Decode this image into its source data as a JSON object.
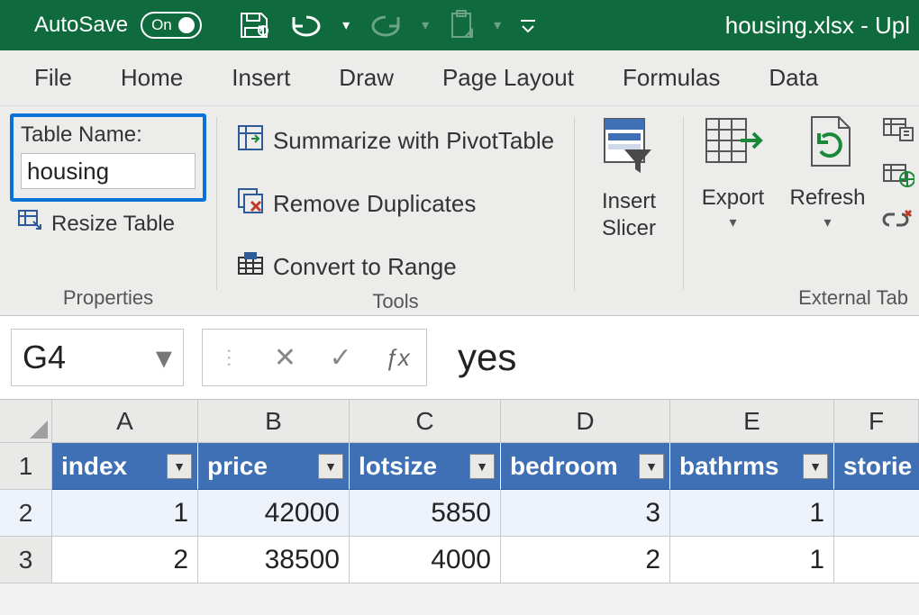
{
  "titlebar": {
    "autosave_label": "AutoSave",
    "autosave_state": "On",
    "doc_title": "housing.xlsx  -  Upl"
  },
  "tabs": {
    "file": "File",
    "home": "Home",
    "insert": "Insert",
    "draw": "Draw",
    "page_layout": "Page Layout",
    "formulas": "Formulas",
    "data": "Data"
  },
  "ribbon": {
    "properties": {
      "label": "Properties",
      "table_name_label": "Table Name:",
      "table_name_value": "housing",
      "resize_table": "Resize Table"
    },
    "tools": {
      "label": "Tools",
      "summarize": "Summarize with PivotTable",
      "remove_dups": "Remove Duplicates",
      "convert_range": "Convert to Range"
    },
    "slicer": {
      "line1": "Insert",
      "line2": "Slicer"
    },
    "export": "Export",
    "refresh": "Refresh",
    "external_label": "External Tab"
  },
  "formula": {
    "namebox": "G4",
    "value": "yes"
  },
  "sheet": {
    "columns": [
      "A",
      "B",
      "C",
      "D",
      "E",
      "F"
    ],
    "header": {
      "A": "index",
      "B": "price",
      "C": "lotsize",
      "D": "bedroom",
      "E": "bathrms",
      "F": "storie"
    },
    "rows": [
      {
        "n": "1"
      },
      {
        "n": "2",
        "A": "1",
        "B": "42000",
        "C": "5850",
        "D": "3",
        "E": "1",
        "F": ""
      },
      {
        "n": "3",
        "A": "2",
        "B": "38500",
        "C": "4000",
        "D": "2",
        "E": "1",
        "F": ""
      }
    ]
  }
}
